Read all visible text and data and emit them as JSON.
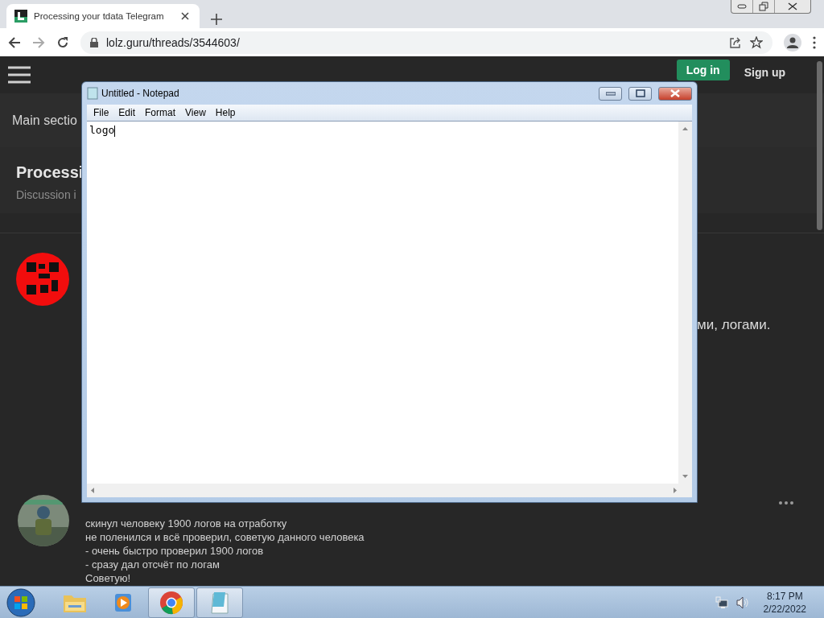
{
  "browser": {
    "tab": {
      "title": "Processing your tdata Telegram",
      "selected": true
    },
    "url": "lolz.guru/threads/3544603/"
  },
  "site": {
    "login": "Log in",
    "signup": "Sign up",
    "breadcrumb": "Main sectio",
    "thread_title": "Processi",
    "thread_subtitle": "Discussion i",
    "first_post_tail": "ми, логами.",
    "second_post_lines": [
      "скинул человеку 1900 логов на отработку",
      "не поленился и всё проверил, советую данного человека",
      "- очень быстро проверил 1900 логов",
      "- сразу дал отсчёт по логам",
      "Советую!"
    ]
  },
  "notepad": {
    "title": "Untitled - Notepad",
    "menu": [
      "File",
      "Edit",
      "Format",
      "View",
      "Help"
    ],
    "content": "logo"
  },
  "taskbar": {
    "apps": [
      {
        "kind": "explorer",
        "active": false
      },
      {
        "kind": "media",
        "active": false
      },
      {
        "kind": "chrome",
        "active": true
      },
      {
        "kind": "notepad",
        "active": true
      }
    ],
    "time": "8:17 PM",
    "date": "2/22/2022"
  }
}
